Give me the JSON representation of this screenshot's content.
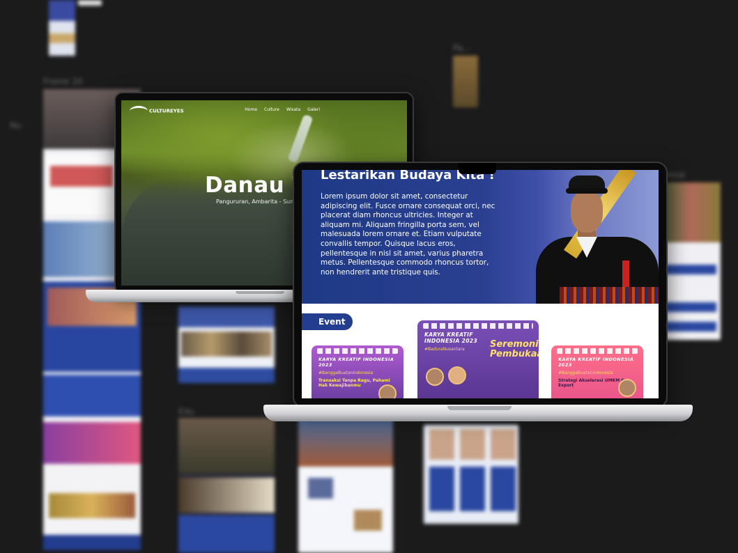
{
  "canvas": {
    "frame_labels": [
      "Frame 20",
      "Pa...",
      "Edu",
      "Nu",
      "Desai"
    ]
  },
  "laptop1": {
    "logo": "CULTUREYES",
    "nav": [
      "Home",
      "Culture",
      "Wisata",
      "Galeri"
    ],
    "title": "Danau To",
    "subtitle": "Pangururan, Ambarita - Sumatera"
  },
  "laptop2": {
    "hero": {
      "title": "Lestarikan Budaya Kita !",
      "body": "Lorem ipsum dolor sit amet, consectetur adipiscing elit. Fusce ornare consequat orci, nec placerat diam rhoncus ultricies. Integer at aliquam mi. Aliquam fringilla porta sem, vel malesuada lorem ornare et. Etiam vulputate convallis tempor. Quisque lacus eros, pellentesque in nisl sit amet, varius pharetra metus. Pellentesque commodo rhoncus tortor, non hendrerit ante tristique quis."
    },
    "event_label": "Event",
    "cards": [
      {
        "title": "KARYA KREATIF INDONESIA 2023",
        "tag": "#BanggaBuatanIndonesia",
        "topic": "Transaksi Tanpa Ragu, Pahami Hak Kewajibanmu"
      },
      {
        "title": "KARYA KREATIF INDONESIA 2023",
        "tag": "#BaduraNusantara",
        "highlight": "Seremoni Pembukaan"
      },
      {
        "title": "KARYA KREATIF INDONESIA 2023",
        "tag": "#BanggaBuatanIndonesia",
        "topic": "Strategi Akselerasi UMKM Go Export"
      }
    ]
  },
  "colors": {
    "brand_blue": "#233d8f",
    "card_purple": "#6a3fa0",
    "card_pink": "#e8558b"
  }
}
